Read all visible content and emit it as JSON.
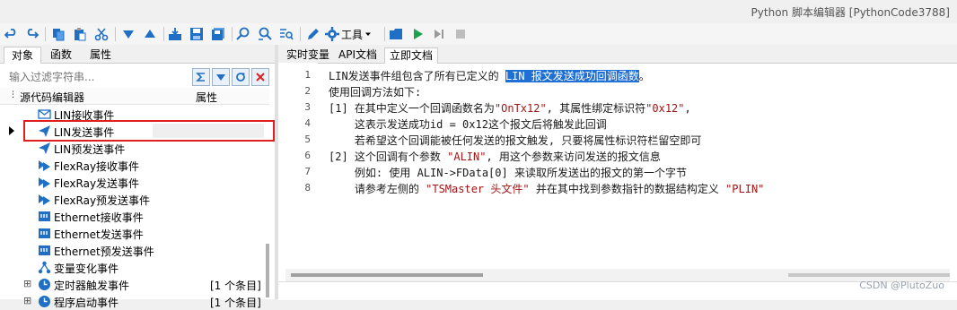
{
  "window": {
    "title": "Python 脚本编辑器 [PythonCode3788]"
  },
  "toolbar": {
    "tools_label": "工具",
    "colors": {
      "blue": "#1f6fc5",
      "green": "#1aa34a",
      "gray": "#9a9a9a"
    }
  },
  "left_panel": {
    "tabs": [
      "对象",
      "函数",
      "属性"
    ],
    "filter_placeholder": "输入过滤字符串...",
    "tree_header": {
      "name": "源代码编辑器",
      "prop": "属性"
    },
    "items": [
      {
        "label": "LIN接收事件",
        "icon": "envelope-icon",
        "count": ""
      },
      {
        "label": "LIN发送事件",
        "icon": "send-icon",
        "count": ""
      },
      {
        "label": "LIN预发送事件",
        "icon": "send-icon",
        "count": ""
      },
      {
        "label": "FlexRay接收事件",
        "icon": "flexray-icon",
        "count": ""
      },
      {
        "label": "FlexRay发送事件",
        "icon": "flexray-icon",
        "count": ""
      },
      {
        "label": "FlexRay预发送事件",
        "icon": "flexray-icon",
        "count": ""
      },
      {
        "label": "Ethernet接收事件",
        "icon": "ethernet-icon",
        "count": ""
      },
      {
        "label": "Ethernet发送事件",
        "icon": "ethernet-icon",
        "count": ""
      },
      {
        "label": "Ethernet预发送事件",
        "icon": "ethernet-icon",
        "count": ""
      },
      {
        "label": "变量变化事件",
        "icon": "variable-icon",
        "count": ""
      },
      {
        "label": "定时器触发事件",
        "icon": "clock-icon",
        "count": "[1 个条目]"
      },
      {
        "label": "程序启动事件",
        "icon": "clock-icon",
        "count": "[1 个条目]"
      }
    ]
  },
  "right_panel": {
    "tabs": [
      "实时变量",
      "API文档",
      "立即文档"
    ],
    "line_numbers": [
      "1",
      "2",
      "3",
      "4",
      "5",
      "6",
      "7",
      "8"
    ],
    "doc": {
      "l1_pre": "LIN发送事件组包含了所有已定义的 ",
      "l1_hl": "LIN 报文发送成功回调函数",
      "l1_post": "。",
      "l2": "使用回调方法如下:",
      "l3_a": "[1] 在其中定义一个回调函数名为",
      "l3_s1": "\"OnTx12\"",
      "l3_b": ", 其属性绑定标识符",
      "l3_s2": "\"0x12\"",
      "l3_c": ",",
      "l4": "    这表示发送成功id = 0x12这个报文后将触发此回调",
      "l5": "    若希望这个回调能被任何发送的报文触发, 只要将属性标识符栏留空即可",
      "l6_a": "[2] 这个回调有个参数 ",
      "l6_s": "\"ALIN\"",
      "l6_b": ", 用这个参数来访问发送的报文信息",
      "l7": "    例如: 使用 ALIN->FData[0] 来读取所发送出的报文的第一个字节",
      "l8_a": "    请参考左侧的 ",
      "l8_s1": "\"TSMaster 头文件\"",
      "l8_b": " 并在其中找到参数指针的数据结构定义 ",
      "l8_s2": "\"PLIN\""
    },
    "watermark": "CSDN @PlutoZuo"
  }
}
